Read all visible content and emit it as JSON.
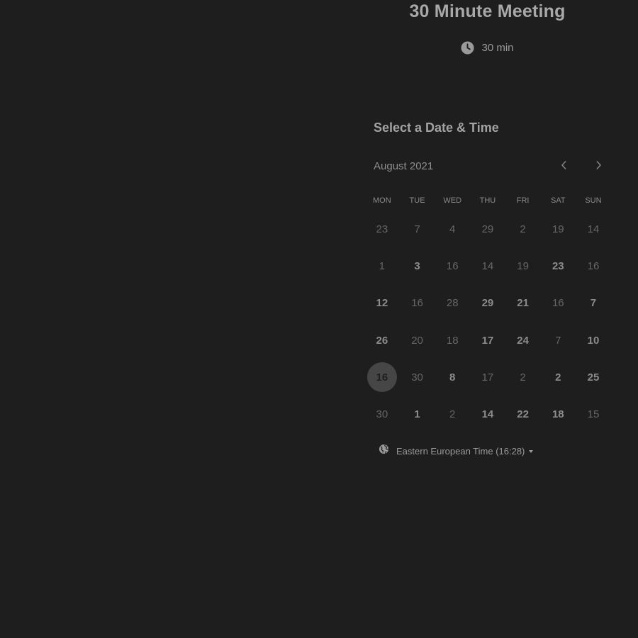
{
  "event": {
    "title": "30 Minute Meeting",
    "duration": "30 min"
  },
  "calendar": {
    "section_title": "Select a Date & Time",
    "month": "August 2021",
    "weekdays": [
      "MON",
      "TUE",
      "WED",
      "THU",
      "FRI",
      "SAT",
      "SUN"
    ],
    "weeks": [
      [
        {
          "d": "23",
          "a": false
        },
        {
          "d": "7",
          "a": false
        },
        {
          "d": "4",
          "a": false
        },
        {
          "d": "29",
          "a": false
        },
        {
          "d": "2",
          "a": false
        },
        {
          "d": "19",
          "a": false
        },
        {
          "d": "14",
          "a": false
        }
      ],
      [
        {
          "d": "1",
          "a": false
        },
        {
          "d": "3",
          "a": true
        },
        {
          "d": "16",
          "a": false
        },
        {
          "d": "14",
          "a": false
        },
        {
          "d": "19",
          "a": false
        },
        {
          "d": "23",
          "a": true
        },
        {
          "d": "16",
          "a": false
        }
      ],
      [
        {
          "d": "12",
          "a": true
        },
        {
          "d": "16",
          "a": false
        },
        {
          "d": "28",
          "a": false
        },
        {
          "d": "29",
          "a": true
        },
        {
          "d": "21",
          "a": true
        },
        {
          "d": "16",
          "a": false
        },
        {
          "d": "7",
          "a": true
        }
      ],
      [
        {
          "d": "26",
          "a": true
        },
        {
          "d": "20",
          "a": false
        },
        {
          "d": "18",
          "a": false
        },
        {
          "d": "17",
          "a": true
        },
        {
          "d": "24",
          "a": true
        },
        {
          "d": "7",
          "a": false
        },
        {
          "d": "10",
          "a": true
        }
      ],
      [
        {
          "d": "16",
          "a": true,
          "selected": true
        },
        {
          "d": "30",
          "a": false
        },
        {
          "d": "8",
          "a": true
        },
        {
          "d": "17",
          "a": false
        },
        {
          "d": "2",
          "a": false
        },
        {
          "d": "2",
          "a": true
        },
        {
          "d": "25",
          "a": true
        }
      ],
      [
        {
          "d": "30",
          "a": false
        },
        {
          "d": "1",
          "a": true
        },
        {
          "d": "2",
          "a": false
        },
        {
          "d": "14",
          "a": true
        },
        {
          "d": "22",
          "a": true
        },
        {
          "d": "18",
          "a": true
        },
        {
          "d": "15",
          "a": false
        }
      ]
    ]
  },
  "timezone": {
    "label": "Eastern European Time (16:28)",
    "icon": "globe-icon"
  },
  "icons": {
    "duration": "clock-icon",
    "prev": "chevron-left-icon",
    "next": "chevron-right-icon"
  }
}
